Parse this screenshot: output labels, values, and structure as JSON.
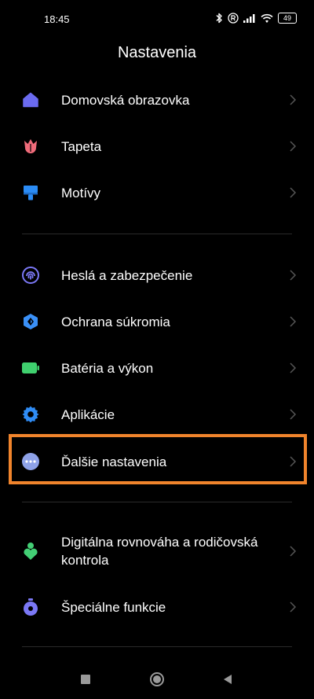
{
  "status_bar": {
    "time": "18:45",
    "battery": "49",
    "icons": [
      "bluetooth-icon",
      "r-circle-icon",
      "signal-icon",
      "wifi-icon",
      "battery-icon"
    ]
  },
  "header": {
    "title": "Nastavenia"
  },
  "colors": {
    "background": "#000000",
    "highlight": "#f0842c",
    "home": "#6b6bf0",
    "wallpaper": "#ef6b7a",
    "themes": "#2b8cf5",
    "passwords": "#7b78f5",
    "privacy": "#3a90f7",
    "battery": "#3fd06e",
    "apps": "#2f8cf5",
    "more": "#8ea2e8",
    "wellbeing": "#43cf75",
    "special": "#7b78f5"
  },
  "settings": {
    "group1": [
      {
        "label": "Domovská obrazovka",
        "icon": "home-icon"
      },
      {
        "label": "Tapeta",
        "icon": "tulip-icon"
      },
      {
        "label": "Motívy",
        "icon": "brush-icon"
      }
    ],
    "group2": [
      {
        "label": "Heslá a zabezpečenie",
        "icon": "fingerprint-icon"
      },
      {
        "label": "Ochrana súkromia",
        "icon": "privacy-icon"
      },
      {
        "label": "Batéria a výkon",
        "icon": "battery-icon"
      },
      {
        "label": "Aplikácie",
        "icon": "gear-icon"
      },
      {
        "label": "Ďalšie nastavenia",
        "icon": "more-dots-icon"
      }
    ],
    "group3": [
      {
        "label": "Digitálna rovnováha a rodičovská kontrola",
        "icon": "wellbeing-icon"
      },
      {
        "label": "Špeciálne funkcie",
        "icon": "special-features-icon"
      }
    ]
  },
  "nav_bar": {
    "buttons": [
      "recent-apps-icon",
      "home-button-icon",
      "back-icon"
    ]
  }
}
